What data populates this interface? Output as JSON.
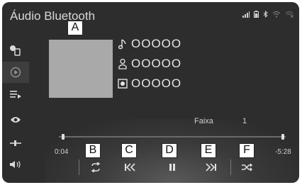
{
  "header": {
    "title": "Áudio Bluetooth"
  },
  "status_icons": [
    "signal-icon",
    "battery-icon",
    "bluetooth-icon",
    "wifi-icon"
  ],
  "sidebar": {
    "items": [
      {
        "icon": "source-phone-icon",
        "active": false
      },
      {
        "icon": "play-circle-icon",
        "active": true
      },
      {
        "icon": "playlist-icon",
        "active": false
      },
      {
        "icon": "eye-icon",
        "active": false
      },
      {
        "icon": "sound-settings-icon",
        "active": false
      },
      {
        "icon": "volume-icon",
        "active": false
      }
    ]
  },
  "track": {
    "song": "OOOOO",
    "artist": "OOOOO",
    "album": "OOOOO",
    "faixa_label": "Faixa",
    "faixa_number": "1"
  },
  "playback": {
    "elapsed": "0:04",
    "remaining": "-5:28",
    "progress_fraction": 0.012
  },
  "controls": [
    {
      "name": "repeat-button",
      "icon": "repeat-icon",
      "callout": "B"
    },
    {
      "name": "previous-button",
      "icon": "previous-icon",
      "callout": "C"
    },
    {
      "name": "pause-button",
      "icon": "pause-icon",
      "callout": "D"
    },
    {
      "name": "next-button",
      "icon": "next-icon",
      "callout": "E"
    },
    {
      "name": "shuffle-button",
      "icon": "shuffle-icon",
      "callout": "F"
    }
  ],
  "callouts": {
    "art": "A",
    "b": "B",
    "c": "C",
    "d": "D",
    "e": "E",
    "f": "F"
  },
  "colors": {
    "screen": "#2d2d2d",
    "text": "#e4e4e4",
    "art": "#a9a9a9"
  }
}
